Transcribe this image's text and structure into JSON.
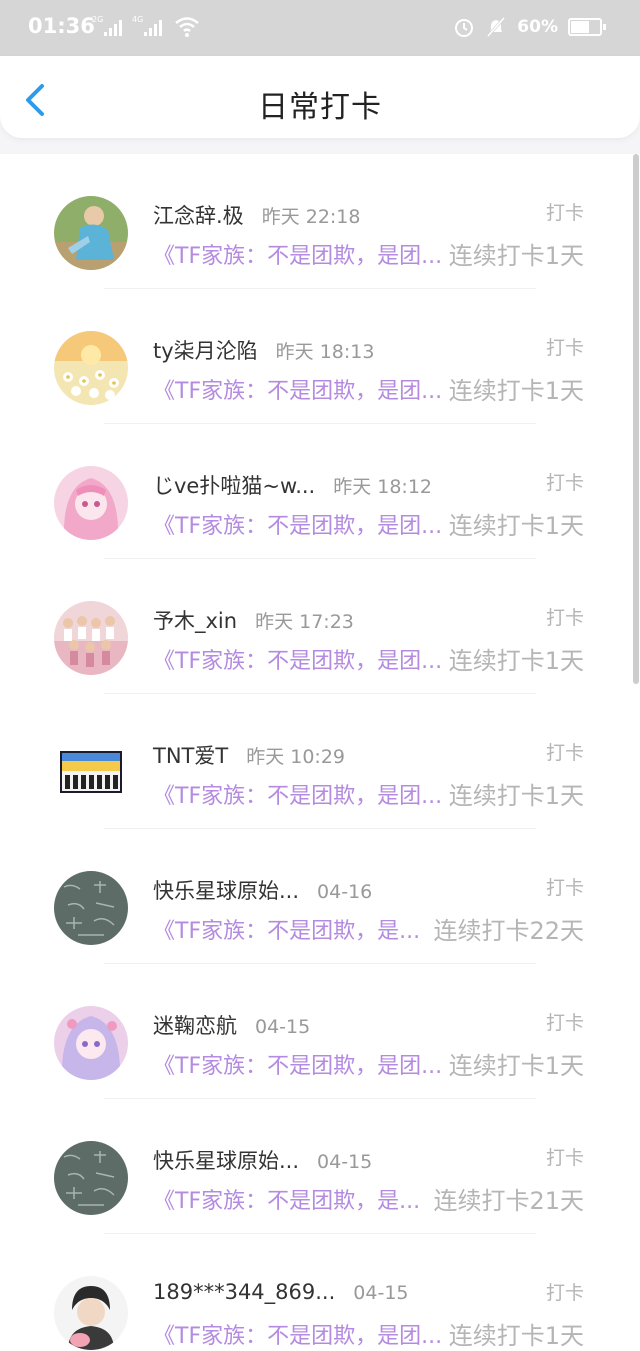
{
  "status": {
    "time": "01:36",
    "sig1": "2G",
    "sig2": "4G",
    "battery": "60%",
    "battery_fill": 0.6
  },
  "header": {
    "title": "日常打卡"
  },
  "items": [
    {
      "name": "江念辞.极",
      "time": "昨天 22:18",
      "tag": "打卡",
      "post": "《TF家族：不是团欺，是团...",
      "streak": "连续打卡1天",
      "avatar": "photo"
    },
    {
      "name": "ty柒月沦陷",
      "time": "昨天 18:13",
      "tag": "打卡",
      "post": "《TF家族：不是团欺，是团...",
      "streak": "连续打卡1天",
      "avatar": "flower"
    },
    {
      "name": "じve扑啦猫~w...",
      "time": "昨天 18:12",
      "tag": "打卡",
      "post": "《TF家族：不是团欺，是团...",
      "streak": "连续打卡1天",
      "avatar": "pink"
    },
    {
      "name": "予木_xin",
      "time": "昨天 17:23",
      "tag": "打卡",
      "post": "《TF家族：不是团欺，是团...",
      "streak": "连续打卡1天",
      "avatar": "group"
    },
    {
      "name": "TNT爱T",
      "time": "昨天 10:29",
      "tag": "打卡",
      "post": "《TF家族：不是团欺，是团...",
      "streak": "连续打卡1天",
      "avatar": "banner"
    },
    {
      "name": "快乐星球原始...",
      "time": "04-16",
      "tag": "打卡",
      "post": "《TF家族：不是团欺，是...",
      "streak": "连续打卡22天",
      "avatar": "board"
    },
    {
      "name": "迷鞠恋航",
      "time": "04-15",
      "tag": "打卡",
      "post": "《TF家族：不是团欺，是团...",
      "streak": "连续打卡1天",
      "avatar": "anime"
    },
    {
      "name": "快乐星球原始...",
      "time": "04-15",
      "tag": "打卡",
      "post": "《TF家族：不是团欺，是...",
      "streak": "连续打卡21天",
      "avatar": "board"
    },
    {
      "name": "189***344_869...",
      "time": "04-15",
      "tag": "打卡",
      "post": "《TF家族：不是团欺，是团...",
      "streak": "连续打卡1天",
      "avatar": "boy"
    }
  ]
}
